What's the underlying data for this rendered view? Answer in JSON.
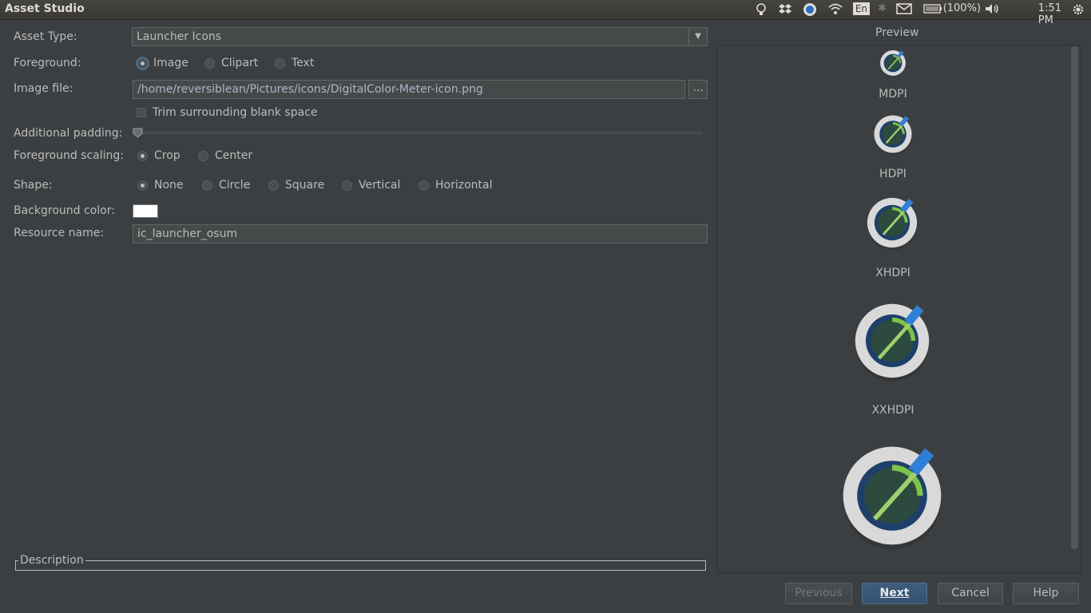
{
  "window": {
    "title": "Asset Studio"
  },
  "tray": {
    "lang": "En",
    "battery": "(100%)",
    "time": "1:51 PM"
  },
  "form": {
    "asset_type_label": "Asset Type:",
    "asset_type_value": "Launcher Icons",
    "foreground_label": "Foreground:",
    "foreground_options": [
      "Image",
      "Clipart",
      "Text"
    ],
    "image_file_label": "Image file:",
    "image_file_value": "/home/reversiblean/Pictures/icons/DigitalColor-Meter-icon.png",
    "browse_label": "...",
    "trim_label": "Trim surrounding blank space",
    "padding_label": "Additional padding:",
    "padding_value": 0,
    "scaling_label": "Foreground scaling:",
    "scaling_options": [
      "Crop",
      "Center"
    ],
    "shape_label": "Shape:",
    "shape_options": [
      "None",
      "Circle",
      "Square",
      "Vertical",
      "Horizontal"
    ],
    "bg_color_label": "Background color:",
    "bg_color_value": "#ffffff",
    "resource_label": "Resource name:",
    "resource_value": "ic_launcher_osum",
    "description_label": "Description"
  },
  "preview": {
    "title": "Preview",
    "densities": [
      "MDPI",
      "HDPI",
      "XHDPI",
      "XXHDPI"
    ]
  },
  "buttons": {
    "previous": "Previous",
    "next": "Next",
    "cancel": "Cancel",
    "help": "Help"
  },
  "colors": {
    "background": "#3c3f41",
    "accent": "#34506e"
  }
}
